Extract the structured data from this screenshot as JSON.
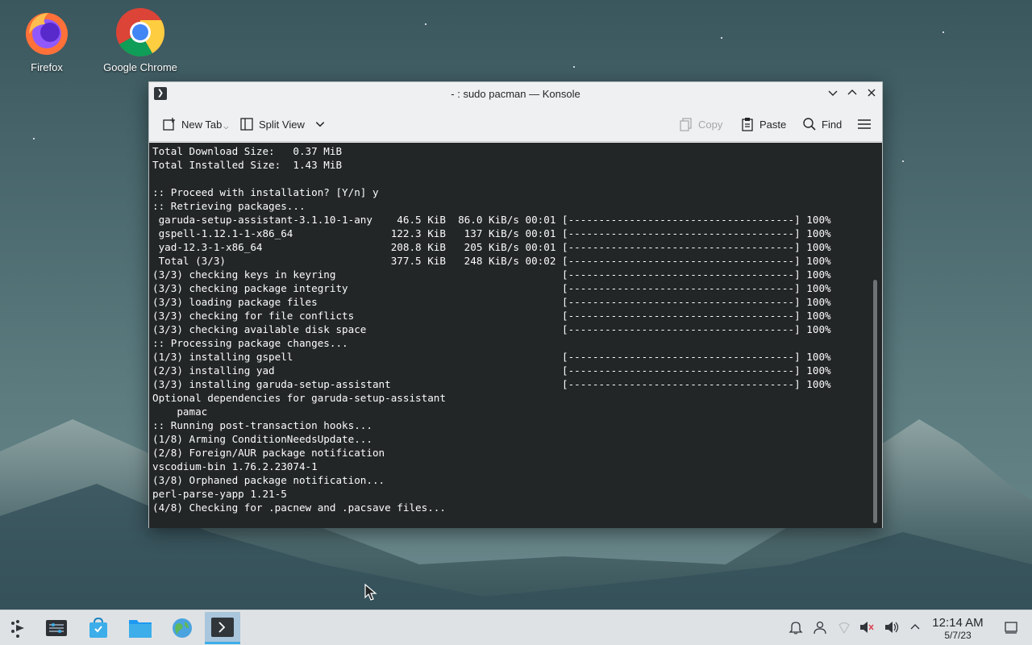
{
  "desktop": {
    "icons": [
      {
        "label": "Firefox",
        "icon": "firefox-icon"
      },
      {
        "label": "Google Chrome",
        "icon": "chrome-icon"
      }
    ]
  },
  "window": {
    "title": "- : sudo pacman — Konsole",
    "toolbar": {
      "new_tab": "New Tab",
      "split_view": "Split View",
      "copy": "Copy",
      "paste": "Paste",
      "find": "Find"
    },
    "terminal_lines": [
      "Total Download Size:   0.37 MiB",
      "Total Installed Size:  1.43 MiB",
      "",
      ":: Proceed with installation? [Y/n] y",
      ":: Retrieving packages...",
      " garuda-setup-assistant-3.1.10-1-any    46.5 KiB  86.0 KiB/s 00:01 [-------------------------------------] 100%",
      " gspell-1.12.1-1-x86_64                122.3 KiB   137 KiB/s 00:01 [-------------------------------------] 100%",
      " yad-12.3-1-x86_64                     208.8 KiB   205 KiB/s 00:01 [-------------------------------------] 100%",
      " Total (3/3)                           377.5 KiB   248 KiB/s 00:02 [-------------------------------------] 100%",
      "(3/3) checking keys in keyring                                     [-------------------------------------] 100%",
      "(3/3) checking package integrity                                   [-------------------------------------] 100%",
      "(3/3) loading package files                                        [-------------------------------------] 100%",
      "(3/3) checking for file conflicts                                  [-------------------------------------] 100%",
      "(3/3) checking available disk space                                [-------------------------------------] 100%",
      ":: Processing package changes...",
      "(1/3) installing gspell                                            [-------------------------------------] 100%",
      "(2/3) installing yad                                               [-------------------------------------] 100%",
      "(3/3) installing garuda-setup-assistant                            [-------------------------------------] 100%",
      "Optional dependencies for garuda-setup-assistant",
      "    pamac",
      ":: Running post-transaction hooks...",
      "(1/8) Arming ConditionNeedsUpdate...",
      "(2/8) Foreign/AUR package notification",
      "vscodium-bin 1.76.2.23074-1",
      "(3/8) Orphaned package notification...",
      "perl-parse-yapp 1.21-5",
      "(4/8) Checking for .pacnew and .pacsave files..."
    ]
  },
  "taskbar": {
    "items": [
      "application-launcher-icon",
      "system-settings-icon",
      "discover-store-icon",
      "file-manager-icon",
      "browser-globe-icon",
      "konsole-icon"
    ],
    "tray": [
      "notifications-icon",
      "user-icon",
      "network-icon",
      "volume-muted-icon",
      "volume-icon",
      "expand-tray-icon"
    ],
    "time": "12:14 AM",
    "date": "5/7/23"
  },
  "colors": {
    "terminal_bg": "#232627",
    "terminal_fg": "#fcfcfc",
    "accent": "#3daee9"
  }
}
